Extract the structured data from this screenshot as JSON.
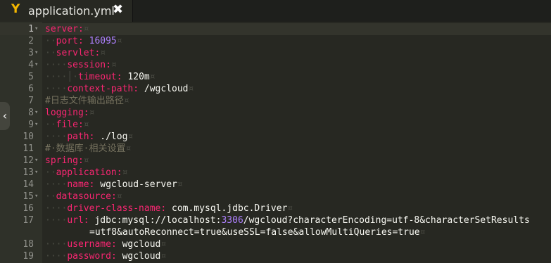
{
  "tab": {
    "title": "application.yml",
    "icon": "yaml-file-icon",
    "close_label": "✖"
  },
  "collapse_label": "‹",
  "lines": [
    {
      "num": "1",
      "fold": "▾",
      "key": "server",
      "colon": ":",
      "ws_end": "¤",
      "indent": ""
    },
    {
      "num": "2",
      "indent": "··",
      "key": "port",
      "colon": ":",
      "sep": " ",
      "num_value": "16095",
      "ws_end": "¤"
    },
    {
      "num": "3",
      "fold": "▾",
      "indent": "··",
      "key": "servlet",
      "colon": ":",
      "ws_end": "¤"
    },
    {
      "num": "4",
      "fold": "▾",
      "indent": "····",
      "key": "session",
      "colon": ":",
      "ws_end": "¤"
    },
    {
      "num": "5",
      "indent": "····│·",
      "key": "timeout",
      "colon": ":",
      "sep": " ",
      "value": "120m",
      "ws_end": "¤"
    },
    {
      "num": "6",
      "indent": "····",
      "key": "context-path",
      "colon": ":",
      "sep": " ",
      "value": "/wgcloud",
      "ws_end": "¤"
    },
    {
      "num": "7",
      "comment": "#日志文件输出路径",
      "ws_end": "¤"
    },
    {
      "num": "8",
      "fold": "▾",
      "key": "logging",
      "colon": ":",
      "ws_end": "¤"
    },
    {
      "num": "9",
      "fold": "▾",
      "indent": "··",
      "key": "file",
      "colon": ":",
      "ws_end": "¤"
    },
    {
      "num": "10",
      "indent": "····",
      "key": "path",
      "colon": ":",
      "sep": " ",
      "value": "./log",
      "ws_end": "¤"
    },
    {
      "num": "11",
      "comment": "#·数据库·相关设置",
      "ws_end": "¤"
    },
    {
      "num": "12",
      "fold": "▾",
      "key": "spring",
      "colon": ":",
      "ws_end": "¤"
    },
    {
      "num": "13",
      "fold": "▾",
      "indent": "··",
      "key": "application",
      "colon": ":",
      "ws_end": "¤"
    },
    {
      "num": "14",
      "indent": "····",
      "key": "name",
      "colon": ":",
      "sep": " ",
      "value": "wgcloud-server",
      "ws_end": "¤"
    },
    {
      "num": "15",
      "fold": "▾",
      "indent": "··",
      "key": "datasource",
      "colon": ":",
      "ws_end": "¤"
    },
    {
      "num": "16",
      "indent": "····",
      "key": "driver-class-name",
      "colon": ":",
      "sep": " ",
      "value": "com.mysql.jdbc.Driver",
      "ws_end": "¤"
    },
    {
      "num": "17",
      "indent": "····",
      "key": "url",
      "colon": ":",
      "sep": " ",
      "value": "jdbc:mysql://localhost:",
      "num_value": "3306",
      "value_tail": "/wgcloud?characterEncoding=utf-8&characterSetResults"
    },
    {
      "num": "18",
      "indent": "····",
      "key": "username",
      "colon": ":",
      "sep": " ",
      "value": "wgcloud",
      "ws_end": "¤"
    },
    {
      "num": "19",
      "indent": "····",
      "key": "password",
      "colon": ":",
      "sep": " ",
      "value": "wgcloud",
      "ws_end": "¤"
    }
  ],
  "wrapped_17": {
    "text": "=utf8&autoReconnect=true&useSSL=false&allowMultiQueries=true",
    "ws_end": "¤"
  }
}
